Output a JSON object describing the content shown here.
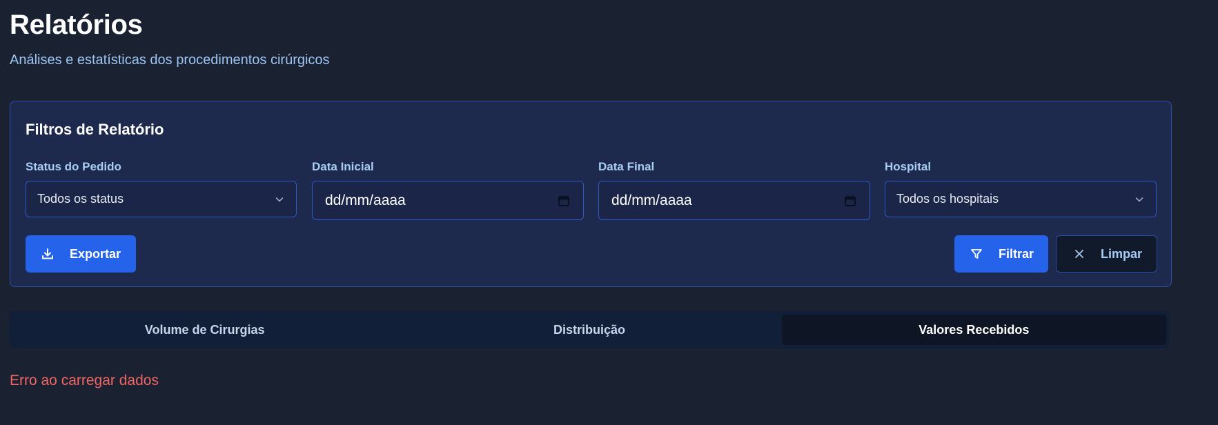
{
  "header": {
    "title": "Relatórios",
    "subtitle": "Análises e estatísticas dos procedimentos cirúrgicos"
  },
  "filters": {
    "title": "Filtros de Relatório",
    "status": {
      "label": "Status do Pedido",
      "value": "Todos os status"
    },
    "start_date": {
      "label": "Data Inicial",
      "value": "dd/mm/aaaa"
    },
    "end_date": {
      "label": "Data Final",
      "value": "dd/mm/aaaa"
    },
    "hospital": {
      "label": "Hospital",
      "value": "Todos os hospitais"
    },
    "export_label": "Exportar",
    "filter_label": "Filtrar",
    "clear_label": "Limpar"
  },
  "tabs": [
    {
      "label": "Volume de Cirurgias",
      "active": false
    },
    {
      "label": "Distribuição",
      "active": false
    },
    {
      "label": "Valores Recebidos",
      "active": true
    }
  ],
  "status_message": "Erro ao carregar dados",
  "icons": {
    "export": "download-icon",
    "filter": "funnel-icon",
    "clear": "close-icon",
    "select": "chevron-down-icon",
    "date": "calendar-icon"
  },
  "colors": {
    "accent": "#2563eb",
    "error": "#f26565"
  }
}
